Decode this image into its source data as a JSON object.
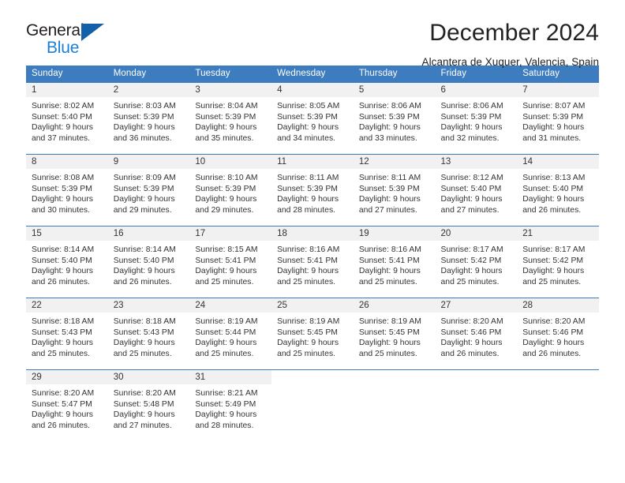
{
  "brand": {
    "word_one": "General",
    "word_two": "Blue",
    "triangle_icon": "triangle-icon"
  },
  "header": {
    "title": "December 2024",
    "subtitle": "Alcantera de Xuquer, Valencia, Spain"
  },
  "colors": {
    "header_blue": "#3d7cbf",
    "brand_blue": "#1c7fd6",
    "brand_triangle": "#1261a8",
    "daynum_band": "#f1f1f1",
    "text": "#333333"
  },
  "weekday_headers": [
    "Sunday",
    "Monday",
    "Tuesday",
    "Wednesday",
    "Thursday",
    "Friday",
    "Saturday"
  ],
  "weeks": [
    [
      {
        "day": "1",
        "sunrise": "Sunrise: 8:02 AM",
        "sunset": "Sunset: 5:40 PM",
        "daylight_line1": "Daylight: 9 hours",
        "daylight_line2": "and 37 minutes."
      },
      {
        "day": "2",
        "sunrise": "Sunrise: 8:03 AM",
        "sunset": "Sunset: 5:39 PM",
        "daylight_line1": "Daylight: 9 hours",
        "daylight_line2": "and 36 minutes."
      },
      {
        "day": "3",
        "sunrise": "Sunrise: 8:04 AM",
        "sunset": "Sunset: 5:39 PM",
        "daylight_line1": "Daylight: 9 hours",
        "daylight_line2": "and 35 minutes."
      },
      {
        "day": "4",
        "sunrise": "Sunrise: 8:05 AM",
        "sunset": "Sunset: 5:39 PM",
        "daylight_line1": "Daylight: 9 hours",
        "daylight_line2": "and 34 minutes."
      },
      {
        "day": "5",
        "sunrise": "Sunrise: 8:06 AM",
        "sunset": "Sunset: 5:39 PM",
        "daylight_line1": "Daylight: 9 hours",
        "daylight_line2": "and 33 minutes."
      },
      {
        "day": "6",
        "sunrise": "Sunrise: 8:06 AM",
        "sunset": "Sunset: 5:39 PM",
        "daylight_line1": "Daylight: 9 hours",
        "daylight_line2": "and 32 minutes."
      },
      {
        "day": "7",
        "sunrise": "Sunrise: 8:07 AM",
        "sunset": "Sunset: 5:39 PM",
        "daylight_line1": "Daylight: 9 hours",
        "daylight_line2": "and 31 minutes."
      }
    ],
    [
      {
        "day": "8",
        "sunrise": "Sunrise: 8:08 AM",
        "sunset": "Sunset: 5:39 PM",
        "daylight_line1": "Daylight: 9 hours",
        "daylight_line2": "and 30 minutes."
      },
      {
        "day": "9",
        "sunrise": "Sunrise: 8:09 AM",
        "sunset": "Sunset: 5:39 PM",
        "daylight_line1": "Daylight: 9 hours",
        "daylight_line2": "and 29 minutes."
      },
      {
        "day": "10",
        "sunrise": "Sunrise: 8:10 AM",
        "sunset": "Sunset: 5:39 PM",
        "daylight_line1": "Daylight: 9 hours",
        "daylight_line2": "and 29 minutes."
      },
      {
        "day": "11",
        "sunrise": "Sunrise: 8:11 AM",
        "sunset": "Sunset: 5:39 PM",
        "daylight_line1": "Daylight: 9 hours",
        "daylight_line2": "and 28 minutes."
      },
      {
        "day": "12",
        "sunrise": "Sunrise: 8:11 AM",
        "sunset": "Sunset: 5:39 PM",
        "daylight_line1": "Daylight: 9 hours",
        "daylight_line2": "and 27 minutes."
      },
      {
        "day": "13",
        "sunrise": "Sunrise: 8:12 AM",
        "sunset": "Sunset: 5:40 PM",
        "daylight_line1": "Daylight: 9 hours",
        "daylight_line2": "and 27 minutes."
      },
      {
        "day": "14",
        "sunrise": "Sunrise: 8:13 AM",
        "sunset": "Sunset: 5:40 PM",
        "daylight_line1": "Daylight: 9 hours",
        "daylight_line2": "and 26 minutes."
      }
    ],
    [
      {
        "day": "15",
        "sunrise": "Sunrise: 8:14 AM",
        "sunset": "Sunset: 5:40 PM",
        "daylight_line1": "Daylight: 9 hours",
        "daylight_line2": "and 26 minutes."
      },
      {
        "day": "16",
        "sunrise": "Sunrise: 8:14 AM",
        "sunset": "Sunset: 5:40 PM",
        "daylight_line1": "Daylight: 9 hours",
        "daylight_line2": "and 26 minutes."
      },
      {
        "day": "17",
        "sunrise": "Sunrise: 8:15 AM",
        "sunset": "Sunset: 5:41 PM",
        "daylight_line1": "Daylight: 9 hours",
        "daylight_line2": "and 25 minutes."
      },
      {
        "day": "18",
        "sunrise": "Sunrise: 8:16 AM",
        "sunset": "Sunset: 5:41 PM",
        "daylight_line1": "Daylight: 9 hours",
        "daylight_line2": "and 25 minutes."
      },
      {
        "day": "19",
        "sunrise": "Sunrise: 8:16 AM",
        "sunset": "Sunset: 5:41 PM",
        "daylight_line1": "Daylight: 9 hours",
        "daylight_line2": "and 25 minutes."
      },
      {
        "day": "20",
        "sunrise": "Sunrise: 8:17 AM",
        "sunset": "Sunset: 5:42 PM",
        "daylight_line1": "Daylight: 9 hours",
        "daylight_line2": "and 25 minutes."
      },
      {
        "day": "21",
        "sunrise": "Sunrise: 8:17 AM",
        "sunset": "Sunset: 5:42 PM",
        "daylight_line1": "Daylight: 9 hours",
        "daylight_line2": "and 25 minutes."
      }
    ],
    [
      {
        "day": "22",
        "sunrise": "Sunrise: 8:18 AM",
        "sunset": "Sunset: 5:43 PM",
        "daylight_line1": "Daylight: 9 hours",
        "daylight_line2": "and 25 minutes."
      },
      {
        "day": "23",
        "sunrise": "Sunrise: 8:18 AM",
        "sunset": "Sunset: 5:43 PM",
        "daylight_line1": "Daylight: 9 hours",
        "daylight_line2": "and 25 minutes."
      },
      {
        "day": "24",
        "sunrise": "Sunrise: 8:19 AM",
        "sunset": "Sunset: 5:44 PM",
        "daylight_line1": "Daylight: 9 hours",
        "daylight_line2": "and 25 minutes."
      },
      {
        "day": "25",
        "sunrise": "Sunrise: 8:19 AM",
        "sunset": "Sunset: 5:45 PM",
        "daylight_line1": "Daylight: 9 hours",
        "daylight_line2": "and 25 minutes."
      },
      {
        "day": "26",
        "sunrise": "Sunrise: 8:19 AM",
        "sunset": "Sunset: 5:45 PM",
        "daylight_line1": "Daylight: 9 hours",
        "daylight_line2": "and 25 minutes."
      },
      {
        "day": "27",
        "sunrise": "Sunrise: 8:20 AM",
        "sunset": "Sunset: 5:46 PM",
        "daylight_line1": "Daylight: 9 hours",
        "daylight_line2": "and 26 minutes."
      },
      {
        "day": "28",
        "sunrise": "Sunrise: 8:20 AM",
        "sunset": "Sunset: 5:46 PM",
        "daylight_line1": "Daylight: 9 hours",
        "daylight_line2": "and 26 minutes."
      }
    ],
    [
      {
        "day": "29",
        "sunrise": "Sunrise: 8:20 AM",
        "sunset": "Sunset: 5:47 PM",
        "daylight_line1": "Daylight: 9 hours",
        "daylight_line2": "and 26 minutes."
      },
      {
        "day": "30",
        "sunrise": "Sunrise: 8:20 AM",
        "sunset": "Sunset: 5:48 PM",
        "daylight_line1": "Daylight: 9 hours",
        "daylight_line2": "and 27 minutes."
      },
      {
        "day": "31",
        "sunrise": "Sunrise: 8:21 AM",
        "sunset": "Sunset: 5:49 PM",
        "daylight_line1": "Daylight: 9 hours",
        "daylight_line2": "and 28 minutes."
      },
      {
        "day": "",
        "sunrise": "",
        "sunset": "",
        "daylight_line1": "",
        "daylight_line2": ""
      },
      {
        "day": "",
        "sunrise": "",
        "sunset": "",
        "daylight_line1": "",
        "daylight_line2": ""
      },
      {
        "day": "",
        "sunrise": "",
        "sunset": "",
        "daylight_line1": "",
        "daylight_line2": ""
      },
      {
        "day": "",
        "sunrise": "",
        "sunset": "",
        "daylight_line1": "",
        "daylight_line2": ""
      }
    ]
  ]
}
